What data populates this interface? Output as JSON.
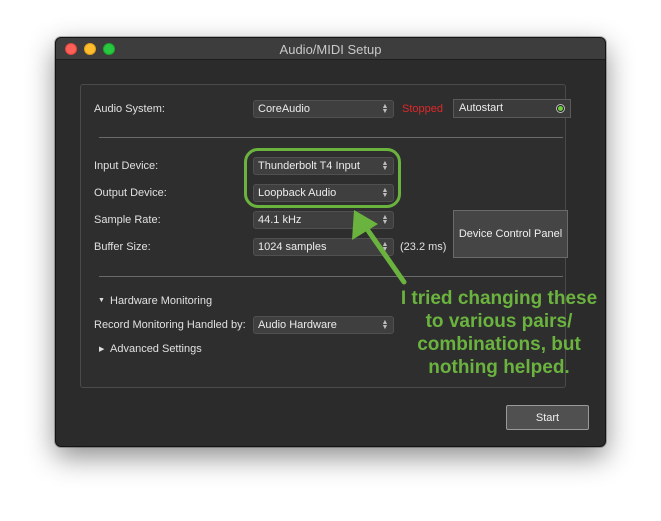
{
  "window": {
    "title": "Audio/MIDI Setup"
  },
  "audio_system": {
    "label": "Audio System:",
    "value": "CoreAudio",
    "status": "Stopped",
    "autostart_label": "Autostart"
  },
  "devices": {
    "input_label": "Input Device:",
    "input_value": "Thunderbolt T4 Input",
    "output_label": "Output Device:",
    "output_value": "Loopback Audio"
  },
  "sample_rate": {
    "label": "Sample Rate:",
    "value": "44.1 kHz"
  },
  "buffer": {
    "label": "Buffer Size:",
    "value": "1024 samples",
    "latency": "(23.2 ms)"
  },
  "device_control_panel": {
    "label": "Device Control Panel"
  },
  "hardware_monitoring": {
    "label": "Hardware Monitoring",
    "record_label": "Record Monitoring Handled by:",
    "record_value": "Audio Hardware"
  },
  "advanced": {
    "label": "Advanced Settings"
  },
  "start": {
    "label": "Start"
  },
  "annotation": {
    "lines": [
      "I tried changing these",
      "to various pairs/",
      "combinations, but",
      "nothing helped."
    ],
    "color": "#6bb33f"
  },
  "colors": {
    "status_stopped": "#e0282a",
    "led_on": "#6fcf3c"
  }
}
